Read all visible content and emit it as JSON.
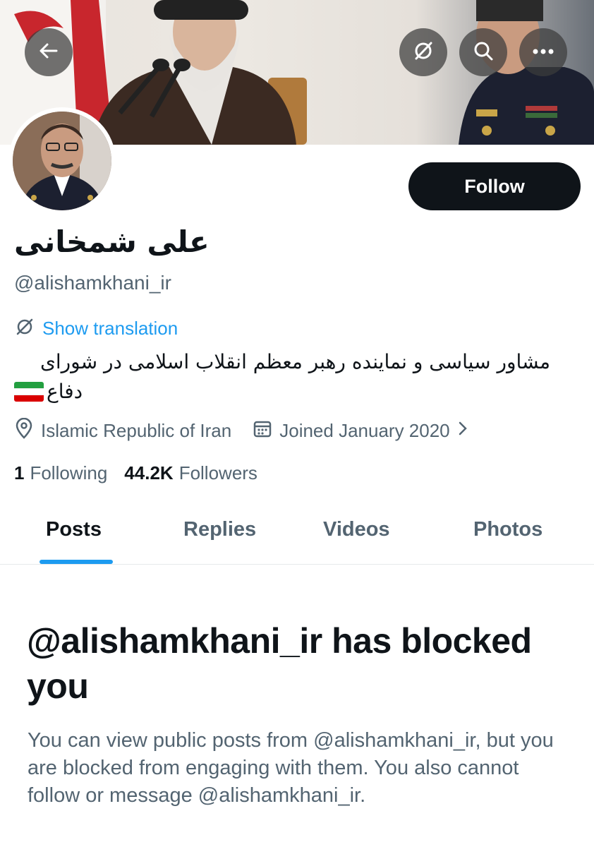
{
  "header": {
    "back_icon": "arrow-left-icon",
    "translate_icon": "translate-icon",
    "search_icon": "search-icon",
    "more_icon": "more-horizontal-icon"
  },
  "profile": {
    "display_name": "علی شمخانی",
    "handle": "@alishamkhani_ir",
    "follow_label": "Follow",
    "show_translation": "Show translation",
    "bio_line1": "مشاور سیاسی و نماینده رهبر معظم انقلاب اسلامی در شورای",
    "bio_line2": "دفاع",
    "location": "Islamic Republic of Iran",
    "joined": "Joined January 2020",
    "following_count": "1",
    "following_label": "Following",
    "followers_count": "44.2K",
    "followers_label": "Followers"
  },
  "tabs": [
    {
      "label": "Posts",
      "active": true
    },
    {
      "label": "Replies",
      "active": false
    },
    {
      "label": "Videos",
      "active": false
    },
    {
      "label": "Photos",
      "active": false
    }
  ],
  "blocked": {
    "title": "@alishamkhani_ir has blocked you",
    "body": "You can view public posts from @alishamkhani_ir, but you are blocked from engaging with them. You also cannot follow or message @alishamkhani_ir."
  },
  "colors": {
    "accent": "#1d9bf0",
    "text_primary": "#0f1419",
    "text_secondary": "#536471",
    "follow_bg": "#0f1419",
    "flag_green": "#239f40",
    "flag_white": "#ffffff",
    "flag_red": "#da0000"
  }
}
